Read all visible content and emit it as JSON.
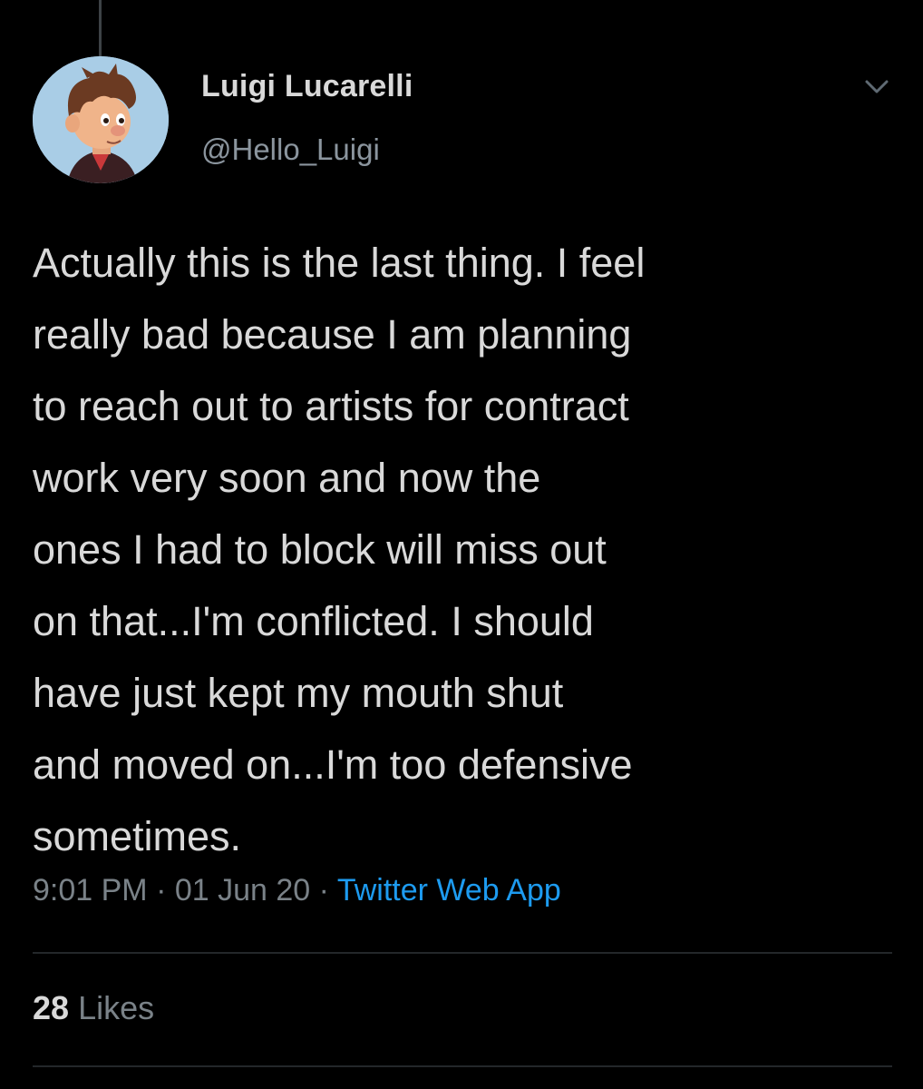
{
  "tweet": {
    "author": {
      "display_name": "Luigi Lucarelli",
      "handle": "@Hello_Luigi",
      "avatar_icon": "cartoon-boy-avatar"
    },
    "text_lines": [
      "Actually this is the last thing. I feel",
      "really bad because I am planning",
      "to reach out to artists for contract",
      "work very soon and now the",
      "ones I had to block will miss out",
      "on that...I'm conflicted. I should",
      "have just kept my mouth shut",
      "and moved on...I'm too defensive",
      "sometimes."
    ],
    "time": "9:01 PM",
    "separator": "·",
    "date": "01 Jun 20",
    "source": "Twitter Web App",
    "likes_count": "28",
    "likes_label": "Likes"
  },
  "colors": {
    "background": "#000000",
    "text": "#d9d9d9",
    "secondary_text": "#8b959e",
    "link": "#1d9bf0",
    "divider": "#23272a"
  },
  "icons": {
    "menu": "chevron-down-icon"
  }
}
